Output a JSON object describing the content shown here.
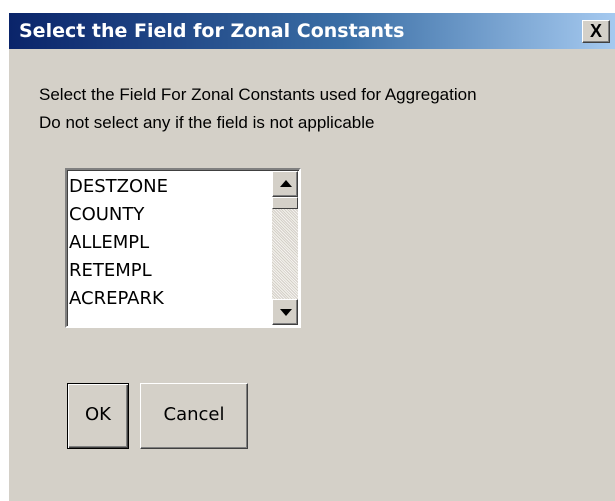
{
  "dialog": {
    "title": "Select the Field for Zonal Constants",
    "close_label": "X"
  },
  "instructions": {
    "line1": "Select the Field For Zonal Constants used for Aggregation",
    "line2": "Do not select any if the field is not applicable"
  },
  "field_list": {
    "items": [
      "DESTZONE",
      "COUNTY",
      "ALLEMPL",
      "RETEMPL",
      "ACREPARK"
    ]
  },
  "buttons": {
    "ok": "OK",
    "cancel": "Cancel"
  },
  "colors": {
    "title_bar_start": "#0a246a",
    "title_bar_end": "#a6caf0",
    "dialog_face": "#d4d0c8"
  }
}
